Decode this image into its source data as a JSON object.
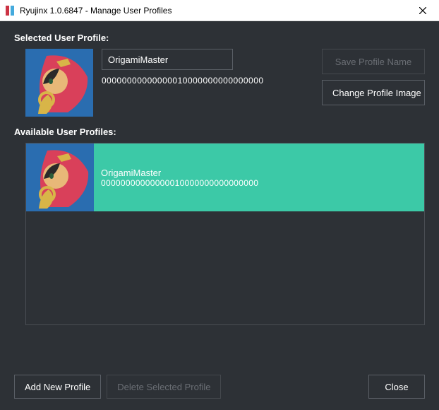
{
  "titlebar": {
    "title": "Ryujinx 1.0.6847 - Manage User Profiles"
  },
  "labels": {
    "selected": "Selected User Profile:",
    "available": "Available User Profiles:"
  },
  "selected_profile": {
    "name": "OrigamiMaster",
    "uid": "00000000000000010000000000000000"
  },
  "buttons": {
    "save": "Save Profile Name",
    "change_image": "Change Profile Image",
    "add": "Add New Profile",
    "delete": "Delete Selected Profile",
    "close": "Close"
  },
  "profiles": [
    {
      "name": "OrigamiMaster",
      "uid": "00000000000000010000000000000000",
      "selected": true
    }
  ],
  "colors": {
    "bg": "#2d3136",
    "selection": "#3cc9a7",
    "border": "#5a5f66"
  }
}
